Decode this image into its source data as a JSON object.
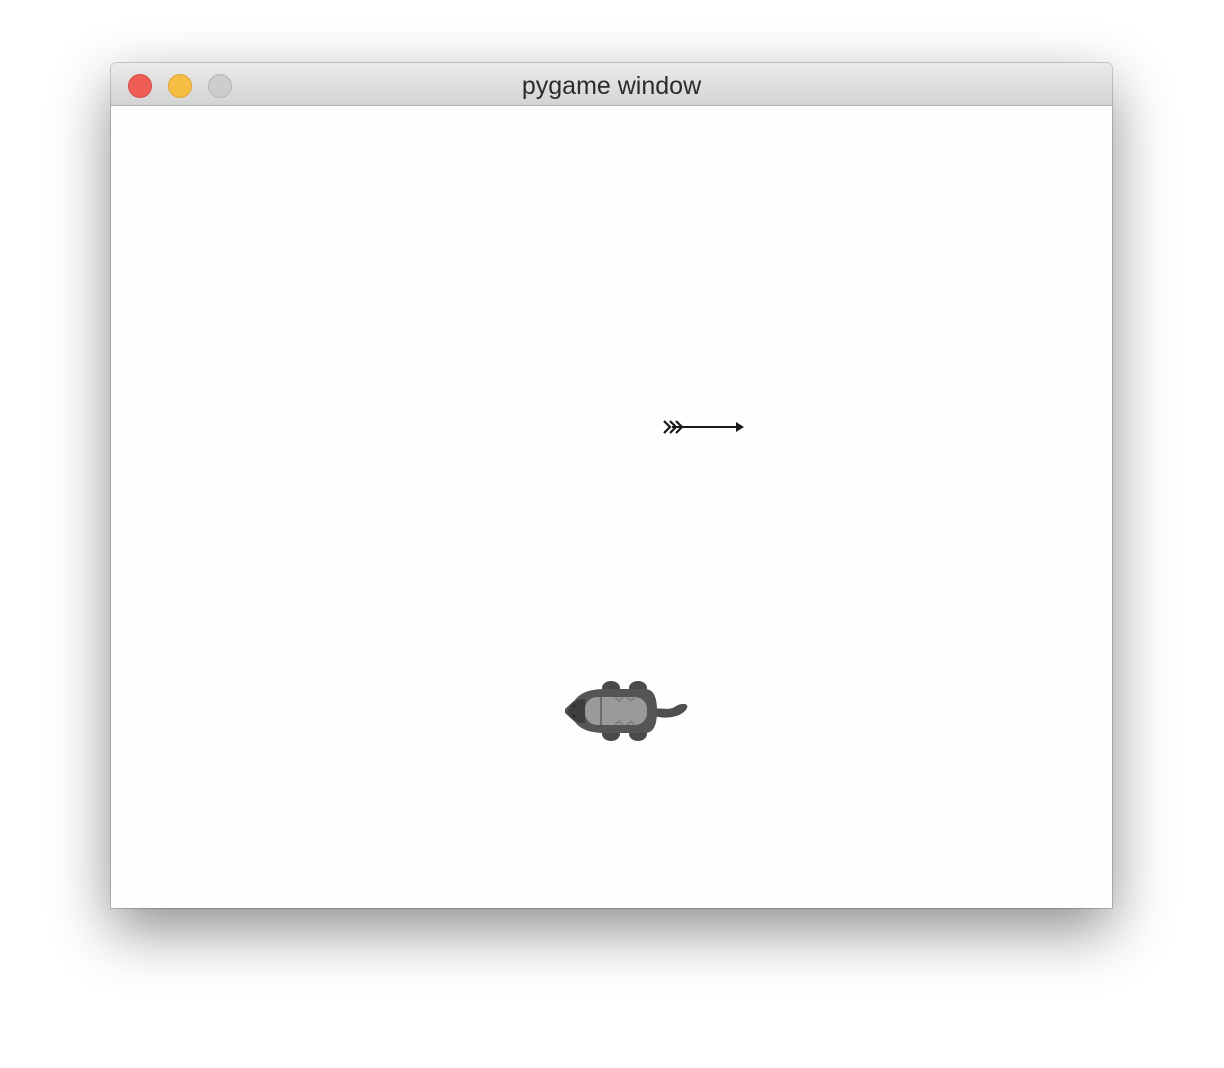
{
  "window": {
    "title": "pygame window",
    "buttons": {
      "close": "close-button",
      "minimize": "minimize-button",
      "zoom": "zoom-button"
    }
  },
  "game": {
    "background_color": "#fefefe",
    "sprites": [
      {
        "name": "arrow-projectile",
        "icon": "arrow-icon"
      },
      {
        "name": "badger-enemy",
        "icon": "badger-icon"
      }
    ]
  }
}
